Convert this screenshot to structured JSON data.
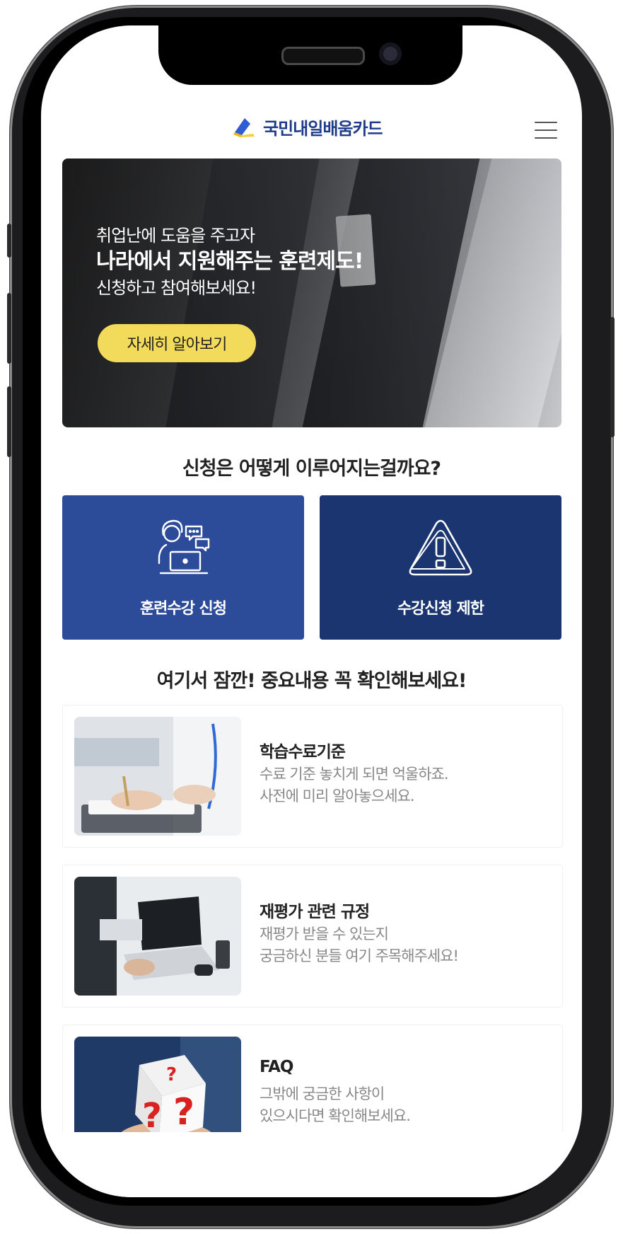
{
  "header": {
    "logo_text": "국민내일배움카드"
  },
  "hero": {
    "line1": "취업난에 도움을 주고자",
    "line2": "나라에서 지원해주는 훈련제도!",
    "line3": "신청하고 참여해보세요!",
    "button_label": "자세히 알아보기"
  },
  "section1": {
    "title": "신청은 어떻게 이루어지는걸까요?",
    "tiles": [
      {
        "label": "훈련수강 신청",
        "icon": "person-laptop-chat-icon",
        "color": "#2c4c9a"
      },
      {
        "label": "수강신청 제한",
        "icon": "warning-triangle-icon",
        "color": "#1a3570"
      }
    ]
  },
  "section2": {
    "title": "여기서 잠깐! 중요내용 꼭 확인해보세요!",
    "cards": [
      {
        "title": "학습수료기준",
        "desc1": "수료 기준 놓치게 되면 억울하죠.",
        "desc2": "사전에 미리 알아놓으세요."
      },
      {
        "title": "재평가 관련 규정",
        "desc1": "재평가 받을 수 있는지",
        "desc2": "궁금하신 분들 여기 주목해주세요!"
      },
      {
        "title": "FAQ",
        "desc1": "그밖에 궁금한 사항이",
        "desc2": "있으시다면 확인해보세요."
      }
    ]
  },
  "colors": {
    "accent_yellow": "#f2db5a",
    "brand_blue": "#1e3a8a"
  }
}
